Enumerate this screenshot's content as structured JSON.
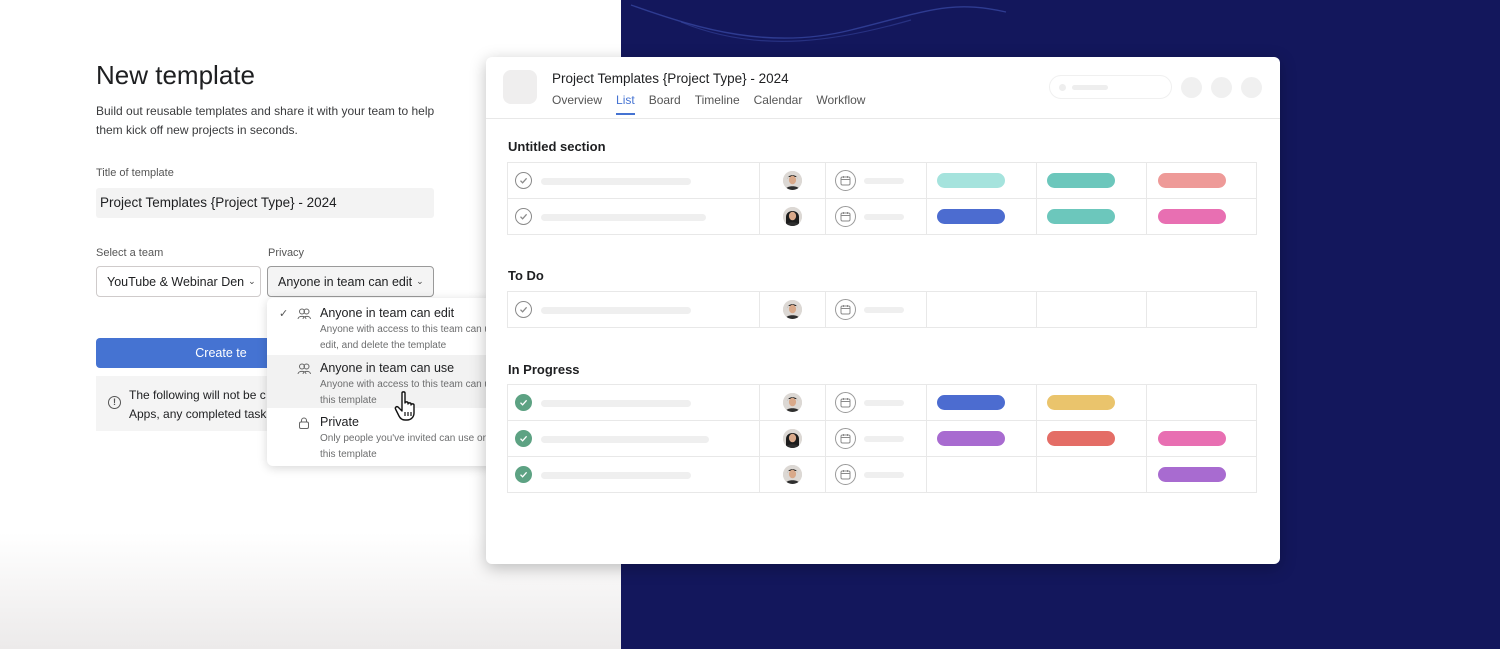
{
  "form": {
    "heading": "New template",
    "description": "Build out reusable templates and share it with your team to help them kick off new projects in seconds.",
    "title_label": "Title of template",
    "title_value": "Project Templates {Project Type} - 2024",
    "team_label": "Select a team",
    "team_value": "YouTube & Webinar Den",
    "privacy_label": "Privacy",
    "privacy_value": "Anyone in team can edit",
    "create_label": "Create te",
    "notice_line1": "The following will not be c",
    "notice_line2": "Apps, any completed task"
  },
  "privacy_options": [
    {
      "title": "Anyone in team can edit",
      "desc": "Anyone with access to this team can use, edit, and delete the template",
      "selected": true,
      "icon": "team-icon"
    },
    {
      "title": "Anyone in team can use",
      "desc": "Anyone with access to this team can use this template",
      "selected": false,
      "icon": "team-icon"
    },
    {
      "title": "Private",
      "desc": "Only people you've invited can use or edit this template",
      "selected": false,
      "icon": "lock-icon"
    }
  ],
  "preview": {
    "title": "Project Templates {Project Type} - 2024",
    "tabs": [
      "Overview",
      "List",
      "Board",
      "Timeline",
      "Calendar",
      "Workflow"
    ],
    "active_tab": "List",
    "sections": [
      {
        "name": "Untitled section",
        "rows": [
          {
            "done": false,
            "avatar": "man-short-hair",
            "tags": [
              "#a5e3dd",
              "#6cc7bc",
              "#ee9a98"
            ]
          },
          {
            "done": false,
            "avatar": "woman-long-hair",
            "tags": [
              "#4c6cd0",
              "#6cc7bc",
              "#e86fb2"
            ]
          }
        ]
      },
      {
        "name": "To Do",
        "rows": [
          {
            "done": false,
            "avatar": "man-short-hair",
            "tags": []
          }
        ]
      },
      {
        "name": "In Progress",
        "rows": [
          {
            "done": true,
            "avatar": "man-short-hair",
            "tags": [
              "#4c6cd0",
              "#eac46c",
              ""
            ]
          },
          {
            "done": true,
            "avatar": "woman-long-hair",
            "tags": [
              "#a86bd0",
              "#e46d66",
              "#e86fb2"
            ]
          },
          {
            "done": true,
            "avatar": "man-short-hair",
            "tags": [
              "",
              "",
              "#a86bd0"
            ]
          }
        ]
      }
    ]
  },
  "colors": {
    "accent": "#4573d2",
    "navy_background": "#13175c",
    "done_green": "#5da283"
  }
}
